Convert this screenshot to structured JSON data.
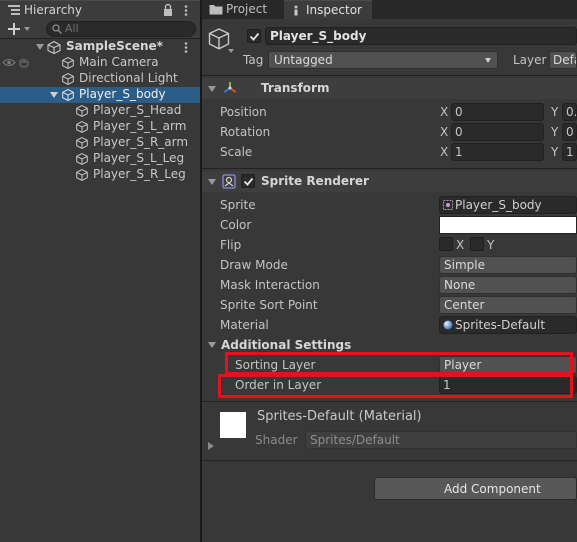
{
  "hierarchy": {
    "tab_label": "Hierarchy",
    "search_placeholder": "All",
    "scene_name": "SampleScene*",
    "items": [
      {
        "label": "Main Camera"
      },
      {
        "label": "Directional Light"
      },
      {
        "label": "Player_S_body",
        "selected": true
      },
      {
        "label": "Player_S_Head"
      },
      {
        "label": "Player_S_L_arm"
      },
      {
        "label": "Player_S_R_arm"
      },
      {
        "label": "Player_S_L_Leg"
      },
      {
        "label": "Player_S_R_Leg"
      }
    ]
  },
  "inspector": {
    "tabs": [
      "Project",
      "Inspector"
    ],
    "object_name": "Player_S_body",
    "tag_label": "Tag",
    "tag_value": "Untagged",
    "layer_label": "Layer",
    "layer_value": "Defa",
    "transform": {
      "title": "Transform",
      "rows": [
        {
          "label": "Position",
          "x": "0",
          "y": "0."
        },
        {
          "label": "Rotation",
          "x": "0",
          "y": "0"
        },
        {
          "label": "Scale",
          "x": "1",
          "y": "1"
        }
      ],
      "x_label": "X",
      "y_label": "Y"
    },
    "sprite_renderer": {
      "title": "Sprite Renderer",
      "sprite_label": "Sprite",
      "sprite_value": "Player_S_body",
      "color_label": "Color",
      "color_value": "#ffffff",
      "flip_label": "Flip",
      "flip_x": "X",
      "flip_y": "Y",
      "draw_mode_label": "Draw Mode",
      "draw_mode_value": "Simple",
      "mask_label": "Mask Interaction",
      "mask_value": "None",
      "sort_point_label": "Sprite Sort Point",
      "sort_point_value": "Center",
      "material_label": "Material",
      "material_value": "Sprites-Default",
      "additional_title": "Additional Settings",
      "sorting_layer_label": "Sorting Layer",
      "sorting_layer_value": "Player",
      "order_label": "Order in Layer",
      "order_value": "1"
    },
    "material": {
      "name": "Sprites-Default (Material)",
      "shader_label": "Shader",
      "shader_value": "Sprites/Default"
    },
    "add_component": "Add Component"
  },
  "colors": {
    "selection": "#2c5d87",
    "highlight_box": "#e0141a"
  }
}
